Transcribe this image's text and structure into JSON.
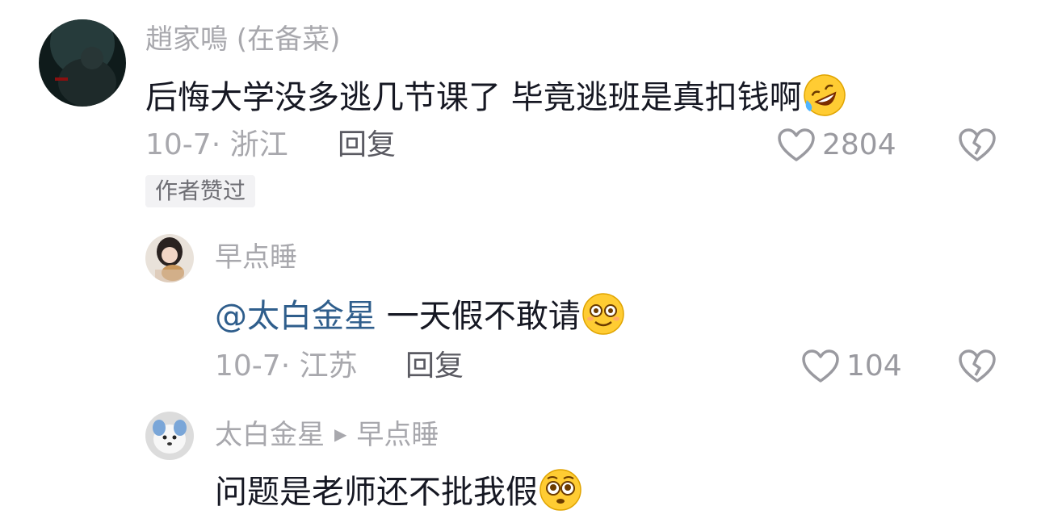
{
  "comments": [
    {
      "username": "趙家鳴 (在备菜)",
      "text": "后悔大学没多逃几节课了  毕竟逃班是真扣钱啊",
      "emoji": "rolling-on-floor-laughing-emoji",
      "date_location": "10-7· 浙江",
      "reply_label": "回复",
      "like_count": "2804",
      "badge": "作者赞过"
    },
    {
      "username": "早点睡",
      "mention": "@太白金星",
      "text": " 一天假不敢请",
      "emoji": "flushed-smile-emoji",
      "date_location": "10-7· 江苏",
      "reply_label": "回复",
      "like_count": "104"
    },
    {
      "username": "太白金星",
      "reply_to": "早点睡",
      "text": "问题是老师还不批我假",
      "emoji": "pleading-face-emoji"
    }
  ],
  "colors": {
    "username": "#a8a8ad",
    "mention": "#2f5e8c",
    "text": "#161823",
    "badge_bg": "#f2f2f4"
  }
}
